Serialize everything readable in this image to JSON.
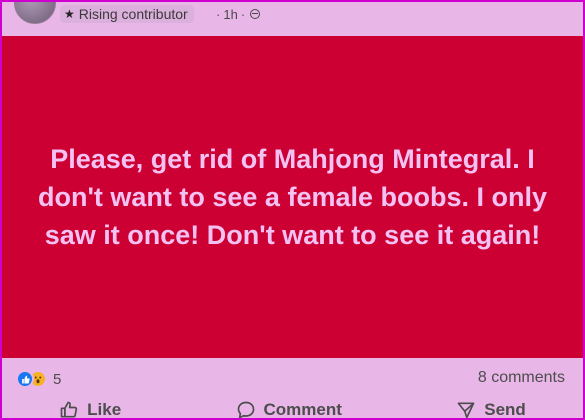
{
  "header": {
    "badge_label": "Rising contributor",
    "time": "1h",
    "separator": "·"
  },
  "post": {
    "text": "Please, get rid of Mahjong Mintegral. I don't want to see a female boobs. I only saw it once! Don't want to see it again!",
    "background_color": "#cc0033",
    "text_color": "#f3c2f3"
  },
  "engagement": {
    "reaction_icons": [
      "like-icon",
      "wow-icon"
    ],
    "reaction_count": "5",
    "comments_label": "8 comments"
  },
  "actions": [
    {
      "label": "Like",
      "icon": "thumbs-up-icon"
    },
    {
      "label": "Comment",
      "icon": "comment-bubble-icon"
    },
    {
      "label": "Send",
      "icon": "send-icon"
    }
  ]
}
